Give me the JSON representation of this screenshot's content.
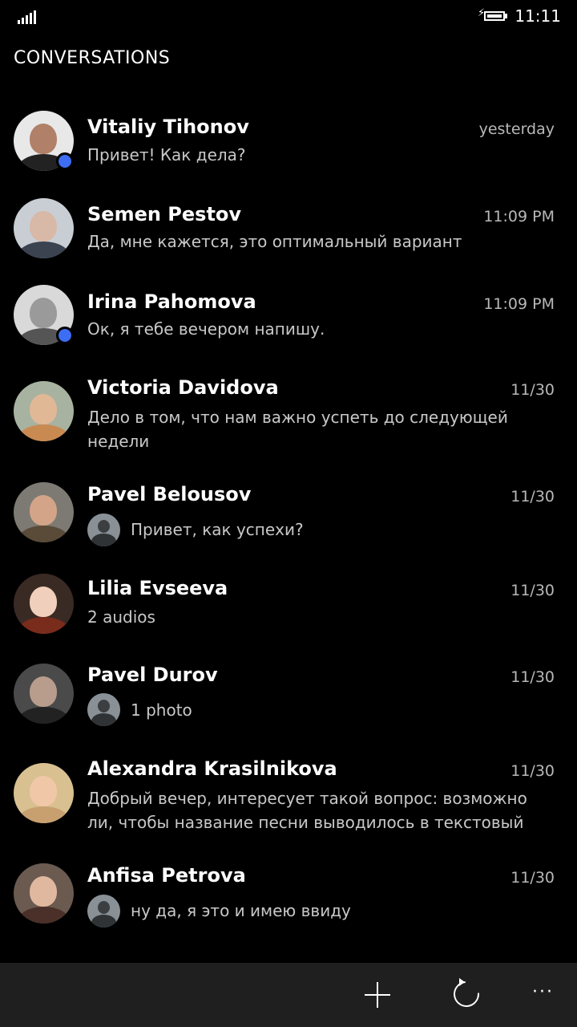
{
  "status_bar": {
    "time": "11:11"
  },
  "page": {
    "title": "CONVERSATIONS"
  },
  "conversations": [
    {
      "name": "Vitaliy Tihonov",
      "time": "yesterday",
      "preview": "Привет! Как дела?",
      "online": true
    },
    {
      "name": "Semen Pestov",
      "time": "11:09 PM",
      "preview": "Да, мне кажется, это оптимальный вариант",
      "online": false
    },
    {
      "name": "Irina Pahomova",
      "time": "11:09 PM",
      "preview": "Ок, я тебе вечером напишу.",
      "online": true
    },
    {
      "name": "Victoria Davidova",
      "time": "11/30",
      "preview": "Дело в том, что нам важно успеть до следующей недели",
      "online": false
    },
    {
      "name": "Pavel Belousov",
      "time": "11/30",
      "preview": "Привет, как успехи?",
      "online": false
    },
    {
      "name": "Lilia Evseeva",
      "time": "11/30",
      "preview": "2 audios",
      "online": false
    },
    {
      "name": "Pavel Durov",
      "time": "11/30",
      "preview": "1 photo",
      "online": false
    },
    {
      "name": "Alexandra Krasilnikova",
      "time": "11/30",
      "preview": "Добрый вечер, интересует такой вопрос: возможно ли, чтобы название песни выводилось в текстовый",
      "online": false
    },
    {
      "name": "Anfisa Petrova",
      "time": "11/30",
      "preview": "ну да, я это и имею ввиду",
      "online": false
    }
  ],
  "app_bar": {
    "buttons": [
      {
        "icon": "plus-icon",
        "label": "new conversation"
      },
      {
        "icon": "refresh-icon",
        "label": "refresh"
      },
      {
        "icon": "more-icon",
        "label": "more"
      }
    ]
  },
  "colors": {
    "background": "#000000",
    "online_indicator": "#3d6df2",
    "app_bar": "#1f1f1f",
    "secondary_text": "#b8b8b8"
  }
}
